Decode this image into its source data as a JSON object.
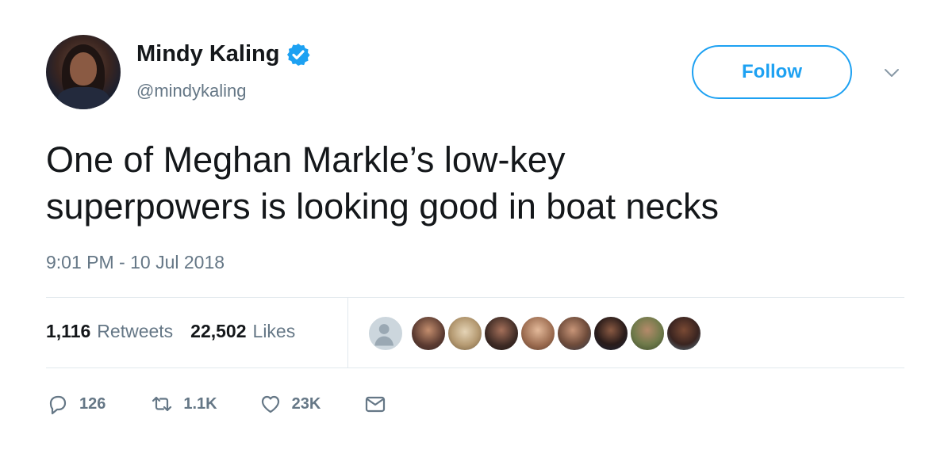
{
  "user": {
    "name": "Mindy Kaling",
    "handle": "@mindykaling",
    "verified_icon": "verified-badge-icon"
  },
  "follow_label": "Follow",
  "tweet": {
    "line1": "One of Meghan Markle’s low-key",
    "line2": "superpowers is looking good in boat necks",
    "timestamp": "9:01 PM - 10 Jul 2018"
  },
  "stats": {
    "retweets_count": "1,116",
    "retweets_label": "Retweets",
    "likes_count": "22,502",
    "likes_label": "Likes"
  },
  "actions": {
    "reply_count": "126",
    "retweet_count": "1.1K",
    "like_count": "23K"
  },
  "colors": {
    "accent": "#1da1f2",
    "secondary_text": "#657786",
    "divider": "#e1e8ed"
  }
}
